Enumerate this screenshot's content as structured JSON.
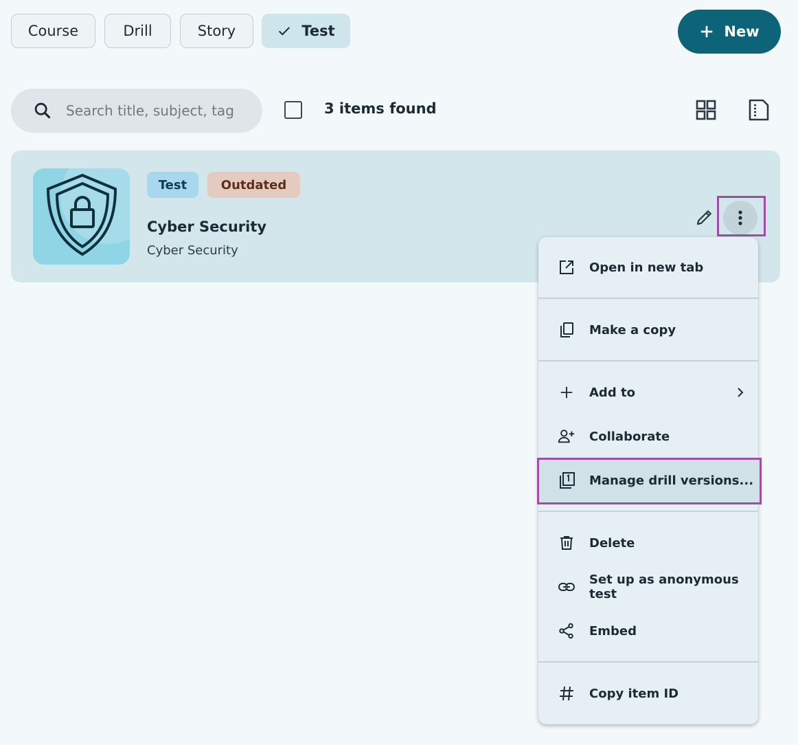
{
  "filters": {
    "course": "Course",
    "drill": "Drill",
    "story": "Story",
    "test": "Test"
  },
  "new_button": "New",
  "search": {
    "placeholder": "Search title, subject, tag"
  },
  "results": {
    "count_text": "3 items found"
  },
  "card": {
    "tags": [
      "Test",
      "Outdated"
    ],
    "title": "Cyber Security",
    "subject": "Cyber Security"
  },
  "menu": {
    "open_new_tab": "Open in new tab",
    "make_copy": "Make a copy",
    "add_to": "Add to",
    "collaborate": "Collaborate",
    "manage_versions": "Manage drill versions...",
    "delete": "Delete",
    "anonymous_test": "Set up as anonymous test",
    "embed": "Embed",
    "copy_id": "Copy item ID"
  },
  "colors": {
    "accent": "#0d6478",
    "highlight": "#a04bad",
    "card_bg": "#d3e6ec",
    "tag_test": "#a9d8ee",
    "tag_outdated": "#e5cbbf"
  }
}
